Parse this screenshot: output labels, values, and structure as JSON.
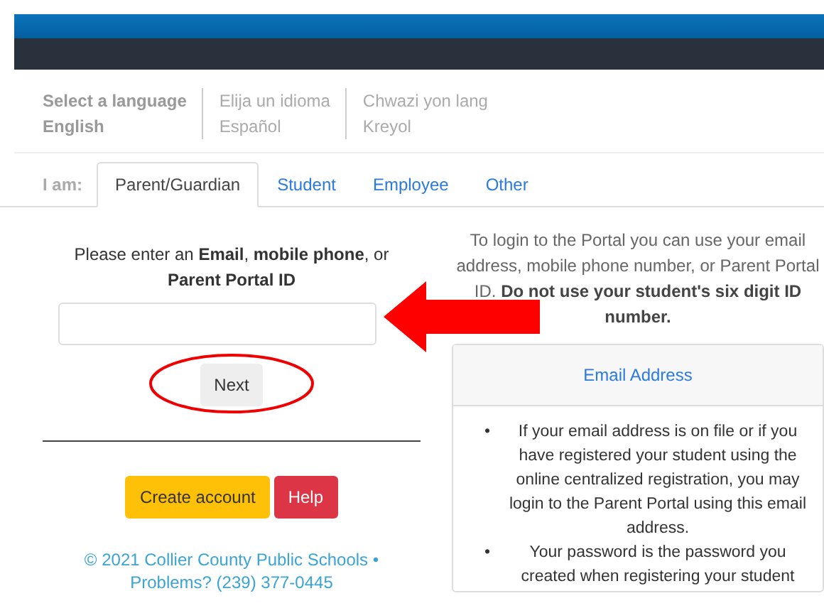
{
  "languages": [
    {
      "prompt": "Select a language",
      "name": "English",
      "selected": true
    },
    {
      "prompt": "Elija un idioma",
      "name": "Español",
      "selected": false
    },
    {
      "prompt": "Chwazi yon lang",
      "name": "Kreyol",
      "selected": false
    }
  ],
  "tabs_label": "I am:",
  "tabs": [
    {
      "label": "Parent/Guardian",
      "selected": true
    },
    {
      "label": "Student",
      "selected": false
    },
    {
      "label": "Employee",
      "selected": false
    },
    {
      "label": "Other",
      "selected": false
    }
  ],
  "login": {
    "prompt": "Please enter an **Email**, **mobile phone**, or **Parent Portal ID**",
    "next": "Next",
    "create": "Create account",
    "help": "Help"
  },
  "footer": [
    "© 2021 Collier County Public Schools •",
    "Problems? (239) 377-0445"
  ],
  "info": {
    "text": "To login to the Portal you can use your email address, mobile phone number, or Parent Portal ID. **Do not use your student's six digit ID number.**",
    "panel_title": "Email Address",
    "bullets": [
      {
        "marker": "•",
        "text": "If your email address is on file or if you have registered your student using the online centralized registration, you may login to the Parent Portal using this email address."
      },
      {
        "marker": "•",
        "text": "Your password is the password you created when registering your student"
      }
    ]
  }
}
